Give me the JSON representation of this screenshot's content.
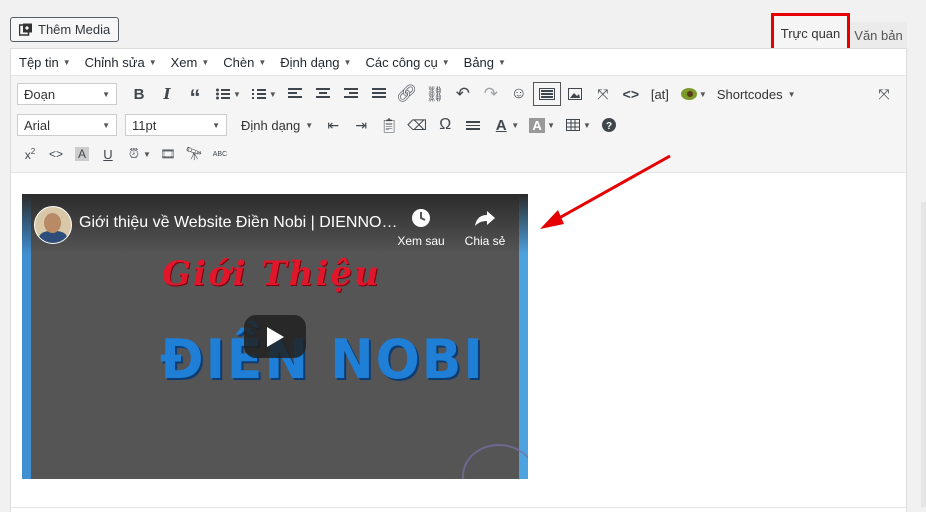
{
  "toolbar_top": {
    "add_media_label": "Thêm Media",
    "tab_visual": "Trực quan",
    "tab_text": "Văn bản"
  },
  "menubar": {
    "items": [
      "Tệp tin",
      "Chỉnh sửa",
      "Xem",
      "Chèn",
      "Định dạng",
      "Các công cụ",
      "Bảng"
    ]
  },
  "toolbar": {
    "paragraph_select": "Đoạn",
    "font_select": "Arial",
    "size_select": "11pt",
    "format_menu": "Định dạng",
    "at_label": "[at]",
    "shortcodes_label": "Shortcodes"
  },
  "video": {
    "title": "Giới thiệu về Website Điền Nobi | DIENNOBI.COM",
    "watch_later": "Xem sau",
    "share": "Chia sẻ",
    "heading_top": "Giới Thiệu",
    "heading_main": "ĐIỀN NOBI"
  },
  "colors": {
    "highlight_border": "#e60000",
    "arrow": "#e60000",
    "heading_red": "#e0162b",
    "heading_blue": "#1f7fd6"
  }
}
